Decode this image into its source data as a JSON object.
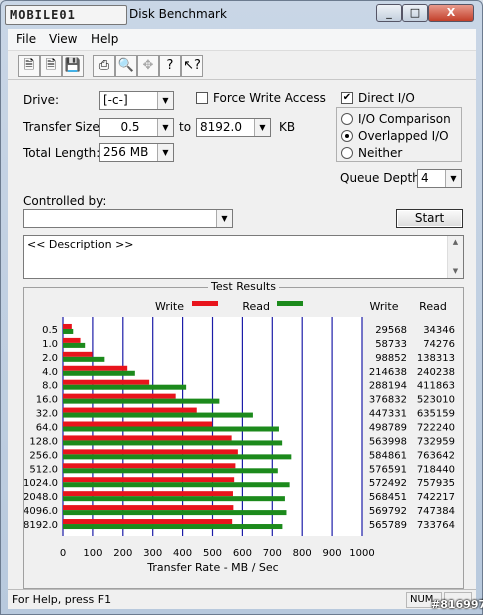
{
  "window": {
    "logo_text": "MOBILE01",
    "title": "Disk Benchmark",
    "min_label": "_",
    "max_label": "□",
    "close_label": "X"
  },
  "menu": {
    "file": "File",
    "view": "View",
    "help": "Help"
  },
  "toolbar": {
    "icons": [
      "new-icon",
      "open-icon",
      "save-icon",
      "print-icon",
      "print-preview-icon",
      "move-icon",
      "help-icon",
      "context-help-icon"
    ]
  },
  "form": {
    "drive_label": "Drive:",
    "drive_value": "[-c-]",
    "force_write_label": "Force Write Access",
    "force_write_checked": false,
    "direct_io_label": "Direct I/O",
    "direct_io_checked": true,
    "transfer_size_label": "Transfer Size:",
    "transfer_from": "0.5",
    "to_label": "to",
    "transfer_to": "8192.0",
    "kb_label": "KB",
    "total_length_label": "Total Length:",
    "total_length_value": "256 MB",
    "io_comparison_label": "I/O Comparison",
    "overlapped_io_label": "Overlapped I/O",
    "neither_label": "Neither",
    "selected_mode": "Overlapped I/O",
    "queue_depth_label": "Queue Depth:",
    "queue_depth_value": "4",
    "controlled_by_label": "Controlled by:",
    "controlled_by_value": "",
    "start_label": "Start",
    "description_text": "<< Description >>"
  },
  "results": {
    "title": "Test Results",
    "write_legend": "Write",
    "read_legend": "Read",
    "write_col": "Write",
    "read_col": "Read",
    "write_color": "#e8141c",
    "read_color": "#1c8a1c",
    "grid_color": "#1c1ca8"
  },
  "chart_data": {
    "type": "bar",
    "orientation": "horizontal",
    "categories": [
      "0.5",
      "1.0",
      "2.0",
      "4.0",
      "8.0",
      "16.0",
      "32.0",
      "64.0",
      "128.0",
      "256.0",
      "512.0",
      "1024.0",
      "2048.0",
      "4096.0",
      "8192.0"
    ],
    "series": [
      {
        "name": "Write",
        "values": [
          29568,
          58733,
          98852,
          214638,
          288194,
          376832,
          447331,
          498789,
          563998,
          584861,
          576591,
          572492,
          568451,
          569792,
          565789
        ]
      },
      {
        "name": "Read",
        "values": [
          34346,
          74276,
          138313,
          240238,
          411863,
          523010,
          635159,
          722240,
          732959,
          763642,
          718440,
          757935,
          742217,
          747384,
          733764
        ]
      }
    ],
    "xlabel": "Transfer Rate - MB / Sec",
    "xlim": [
      0,
      1000
    ],
    "xticks": [
      "0",
      "100",
      "200",
      "300",
      "400",
      "500",
      "600",
      "700",
      "800",
      "900",
      "1000"
    ],
    "grid": true,
    "legend": "top-center"
  },
  "status": {
    "help_text": "For Help, press F1",
    "num_label": "NUM"
  },
  "watermark": "#816997"
}
